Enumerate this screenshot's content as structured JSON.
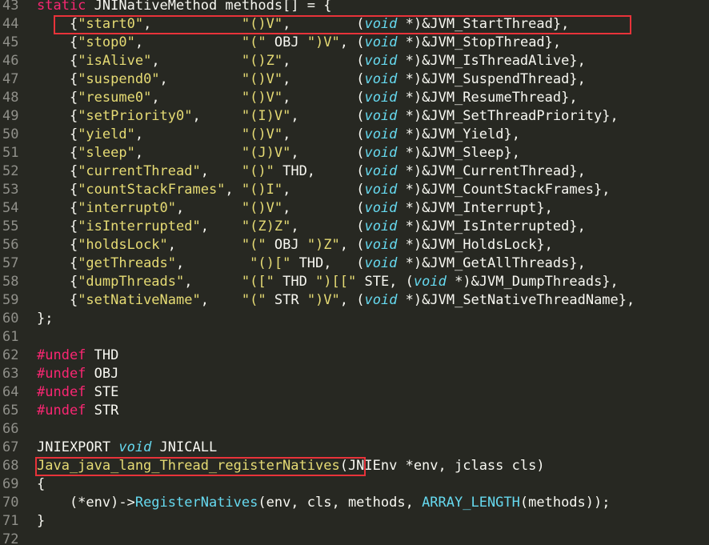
{
  "editor": {
    "lines": [
      {
        "num": "43",
        "tokens": [
          {
            "c": "kw",
            "t": "static"
          },
          {
            "c": "plain",
            "t": " JNINativeMethod methods[] = {"
          }
        ]
      },
      {
        "num": "44",
        "tokens": [
          {
            "c": "plain",
            "t": "    {"
          },
          {
            "c": "str",
            "t": "\"start0\""
          },
          {
            "c": "plain",
            "t": ",           "
          },
          {
            "c": "str",
            "t": "\"()V\""
          },
          {
            "c": "plain",
            "t": ",        ("
          },
          {
            "c": "ty",
            "t": "void"
          },
          {
            "c": "plain",
            "t": " *)&JVM_StartThread},"
          }
        ]
      },
      {
        "num": "45",
        "tokens": [
          {
            "c": "plain",
            "t": "    {"
          },
          {
            "c": "str",
            "t": "\"stop0\""
          },
          {
            "c": "plain",
            "t": ",            "
          },
          {
            "c": "str",
            "t": "\"(\""
          },
          {
            "c": "plain",
            "t": " OBJ "
          },
          {
            "c": "str",
            "t": "\")V\""
          },
          {
            "c": "plain",
            "t": ", ("
          },
          {
            "c": "ty",
            "t": "void"
          },
          {
            "c": "plain",
            "t": " *)&JVM_StopThread},"
          }
        ]
      },
      {
        "num": "46",
        "tokens": [
          {
            "c": "plain",
            "t": "    {"
          },
          {
            "c": "str",
            "t": "\"isAlive\""
          },
          {
            "c": "plain",
            "t": ",          "
          },
          {
            "c": "str",
            "t": "\"()Z\""
          },
          {
            "c": "plain",
            "t": ",        ("
          },
          {
            "c": "ty",
            "t": "void"
          },
          {
            "c": "plain",
            "t": " *)&JVM_IsThreadAlive},"
          }
        ]
      },
      {
        "num": "47",
        "tokens": [
          {
            "c": "plain",
            "t": "    {"
          },
          {
            "c": "str",
            "t": "\"suspend0\""
          },
          {
            "c": "plain",
            "t": ",         "
          },
          {
            "c": "str",
            "t": "\"()V\""
          },
          {
            "c": "plain",
            "t": ",        ("
          },
          {
            "c": "ty",
            "t": "void"
          },
          {
            "c": "plain",
            "t": " *)&JVM_SuspendThread},"
          }
        ]
      },
      {
        "num": "48",
        "tokens": [
          {
            "c": "plain",
            "t": "    {"
          },
          {
            "c": "str",
            "t": "\"resume0\""
          },
          {
            "c": "plain",
            "t": ",          "
          },
          {
            "c": "str",
            "t": "\"()V\""
          },
          {
            "c": "plain",
            "t": ",        ("
          },
          {
            "c": "ty",
            "t": "void"
          },
          {
            "c": "plain",
            "t": " *)&JVM_ResumeThread},"
          }
        ]
      },
      {
        "num": "49",
        "tokens": [
          {
            "c": "plain",
            "t": "    {"
          },
          {
            "c": "str",
            "t": "\"setPriority0\""
          },
          {
            "c": "plain",
            "t": ",     "
          },
          {
            "c": "str",
            "t": "\"(I)V\""
          },
          {
            "c": "plain",
            "t": ",       ("
          },
          {
            "c": "ty",
            "t": "void"
          },
          {
            "c": "plain",
            "t": " *)&JVM_SetThreadPriority},"
          }
        ]
      },
      {
        "num": "50",
        "tokens": [
          {
            "c": "plain",
            "t": "    {"
          },
          {
            "c": "str",
            "t": "\"yield\""
          },
          {
            "c": "plain",
            "t": ",            "
          },
          {
            "c": "str",
            "t": "\"()V\""
          },
          {
            "c": "plain",
            "t": ",        ("
          },
          {
            "c": "ty",
            "t": "void"
          },
          {
            "c": "plain",
            "t": " *)&JVM_Yield},"
          }
        ]
      },
      {
        "num": "51",
        "tokens": [
          {
            "c": "plain",
            "t": "    {"
          },
          {
            "c": "str",
            "t": "\"sleep\""
          },
          {
            "c": "plain",
            "t": ",            "
          },
          {
            "c": "str",
            "t": "\"(J)V\""
          },
          {
            "c": "plain",
            "t": ",       ("
          },
          {
            "c": "ty",
            "t": "void"
          },
          {
            "c": "plain",
            "t": " *)&JVM_Sleep},"
          }
        ]
      },
      {
        "num": "52",
        "tokens": [
          {
            "c": "plain",
            "t": "    {"
          },
          {
            "c": "str",
            "t": "\"currentThread\""
          },
          {
            "c": "plain",
            "t": ",    "
          },
          {
            "c": "str",
            "t": "\"()\""
          },
          {
            "c": "plain",
            "t": " THD,     ("
          },
          {
            "c": "ty",
            "t": "void"
          },
          {
            "c": "plain",
            "t": " *)&JVM_CurrentThread},"
          }
        ]
      },
      {
        "num": "53",
        "tokens": [
          {
            "c": "plain",
            "t": "    {"
          },
          {
            "c": "str",
            "t": "\"countStackFrames\""
          },
          {
            "c": "plain",
            "t": ", "
          },
          {
            "c": "str",
            "t": "\"()I\""
          },
          {
            "c": "plain",
            "t": ",        ("
          },
          {
            "c": "ty",
            "t": "void"
          },
          {
            "c": "plain",
            "t": " *)&JVM_CountStackFrames},"
          }
        ]
      },
      {
        "num": "54",
        "tokens": [
          {
            "c": "plain",
            "t": "    {"
          },
          {
            "c": "str",
            "t": "\"interrupt0\""
          },
          {
            "c": "plain",
            "t": ",       "
          },
          {
            "c": "str",
            "t": "\"()V\""
          },
          {
            "c": "plain",
            "t": ",        ("
          },
          {
            "c": "ty",
            "t": "void"
          },
          {
            "c": "plain",
            "t": " *)&JVM_Interrupt},"
          }
        ]
      },
      {
        "num": "55",
        "tokens": [
          {
            "c": "plain",
            "t": "    {"
          },
          {
            "c": "str",
            "t": "\"isInterrupted\""
          },
          {
            "c": "plain",
            "t": ",    "
          },
          {
            "c": "str",
            "t": "\"(Z)Z\""
          },
          {
            "c": "plain",
            "t": ",       ("
          },
          {
            "c": "ty",
            "t": "void"
          },
          {
            "c": "plain",
            "t": " *)&JVM_IsInterrupted},"
          }
        ]
      },
      {
        "num": "56",
        "tokens": [
          {
            "c": "plain",
            "t": "    {"
          },
          {
            "c": "str",
            "t": "\"holdsLock\""
          },
          {
            "c": "plain",
            "t": ",        "
          },
          {
            "c": "str",
            "t": "\"(\""
          },
          {
            "c": "plain",
            "t": " OBJ "
          },
          {
            "c": "str",
            "t": "\")Z\""
          },
          {
            "c": "plain",
            "t": ", ("
          },
          {
            "c": "ty",
            "t": "void"
          },
          {
            "c": "plain",
            "t": " *)&JVM_HoldsLock},"
          }
        ]
      },
      {
        "num": "57",
        "tokens": [
          {
            "c": "plain",
            "t": "    {"
          },
          {
            "c": "str",
            "t": "\"getThreads\""
          },
          {
            "c": "plain",
            "t": ",        "
          },
          {
            "c": "str",
            "t": "\"()[\""
          },
          {
            "c": "plain",
            "t": " THD,   ("
          },
          {
            "c": "ty",
            "t": "void"
          },
          {
            "c": "plain",
            "t": " *)&JVM_GetAllThreads},"
          }
        ]
      },
      {
        "num": "58",
        "tokens": [
          {
            "c": "plain",
            "t": "    {"
          },
          {
            "c": "str",
            "t": "\"dumpThreads\""
          },
          {
            "c": "plain",
            "t": ",      "
          },
          {
            "c": "str",
            "t": "\"([\""
          },
          {
            "c": "plain",
            "t": " THD "
          },
          {
            "c": "str",
            "t": "\")[[\""
          },
          {
            "c": "plain",
            "t": " STE, ("
          },
          {
            "c": "ty",
            "t": "void"
          },
          {
            "c": "plain",
            "t": " *)&JVM_DumpThreads},"
          }
        ]
      },
      {
        "num": "59",
        "tokens": [
          {
            "c": "plain",
            "t": "    {"
          },
          {
            "c": "str",
            "t": "\"setNativeName\""
          },
          {
            "c": "plain",
            "t": ",    "
          },
          {
            "c": "str",
            "t": "\"(\""
          },
          {
            "c": "plain",
            "t": " STR "
          },
          {
            "c": "str",
            "t": "\")V\""
          },
          {
            "c": "plain",
            "t": ", ("
          },
          {
            "c": "ty",
            "t": "void"
          },
          {
            "c": "plain",
            "t": " *)&JVM_SetNativeThreadName},"
          }
        ]
      },
      {
        "num": "60",
        "tokens": [
          {
            "c": "plain",
            "t": "};"
          }
        ]
      },
      {
        "num": "61",
        "tokens": []
      },
      {
        "num": "62",
        "tokens": [
          {
            "c": "kw",
            "t": "#undef"
          },
          {
            "c": "plain",
            "t": " THD"
          }
        ]
      },
      {
        "num": "63",
        "tokens": [
          {
            "c": "kw",
            "t": "#undef"
          },
          {
            "c": "plain",
            "t": " OBJ"
          }
        ]
      },
      {
        "num": "64",
        "tokens": [
          {
            "c": "kw",
            "t": "#undef"
          },
          {
            "c": "plain",
            "t": " STE"
          }
        ]
      },
      {
        "num": "65",
        "tokens": [
          {
            "c": "kw",
            "t": "#undef"
          },
          {
            "c": "plain",
            "t": " STR"
          }
        ]
      },
      {
        "num": "66",
        "tokens": []
      },
      {
        "num": "67",
        "tokens": [
          {
            "c": "plain",
            "t": "JNIEXPORT "
          },
          {
            "c": "ty",
            "t": "void"
          },
          {
            "c": "plain",
            "t": " JNICALL"
          }
        ]
      },
      {
        "num": "68",
        "tokens": [
          {
            "c": "str",
            "t": "Java_java_lang_Thread_registerNatives"
          },
          {
            "c": "plain",
            "t": "(JNIEnv *env, jclass cls)"
          }
        ]
      },
      {
        "num": "69",
        "tokens": [
          {
            "c": "plain",
            "t": "{"
          }
        ]
      },
      {
        "num": "70",
        "tokens": [
          {
            "c": "plain",
            "t": "    (*env)->"
          },
          {
            "c": "fn",
            "t": "RegisterNatives"
          },
          {
            "c": "plain",
            "t": "(env, cls, methods, "
          },
          {
            "c": "fn",
            "t": "ARRAY_LENGTH"
          },
          {
            "c": "plain",
            "t": "(methods));"
          }
        ]
      },
      {
        "num": "71",
        "tokens": [
          {
            "c": "plain",
            "t": "}"
          }
        ]
      },
      {
        "num": "72",
        "tokens": []
      }
    ]
  },
  "highlights": [
    {
      "label": "start0-entry",
      "line": "44"
    },
    {
      "label": "register-natives-function",
      "line": "68"
    }
  ],
  "colors": {
    "background": "#272822",
    "keyword": "#f92672",
    "string": "#e6db74",
    "type": "#66d9ef",
    "gutter": "#90908a",
    "highlight_box": "#e8333a"
  }
}
